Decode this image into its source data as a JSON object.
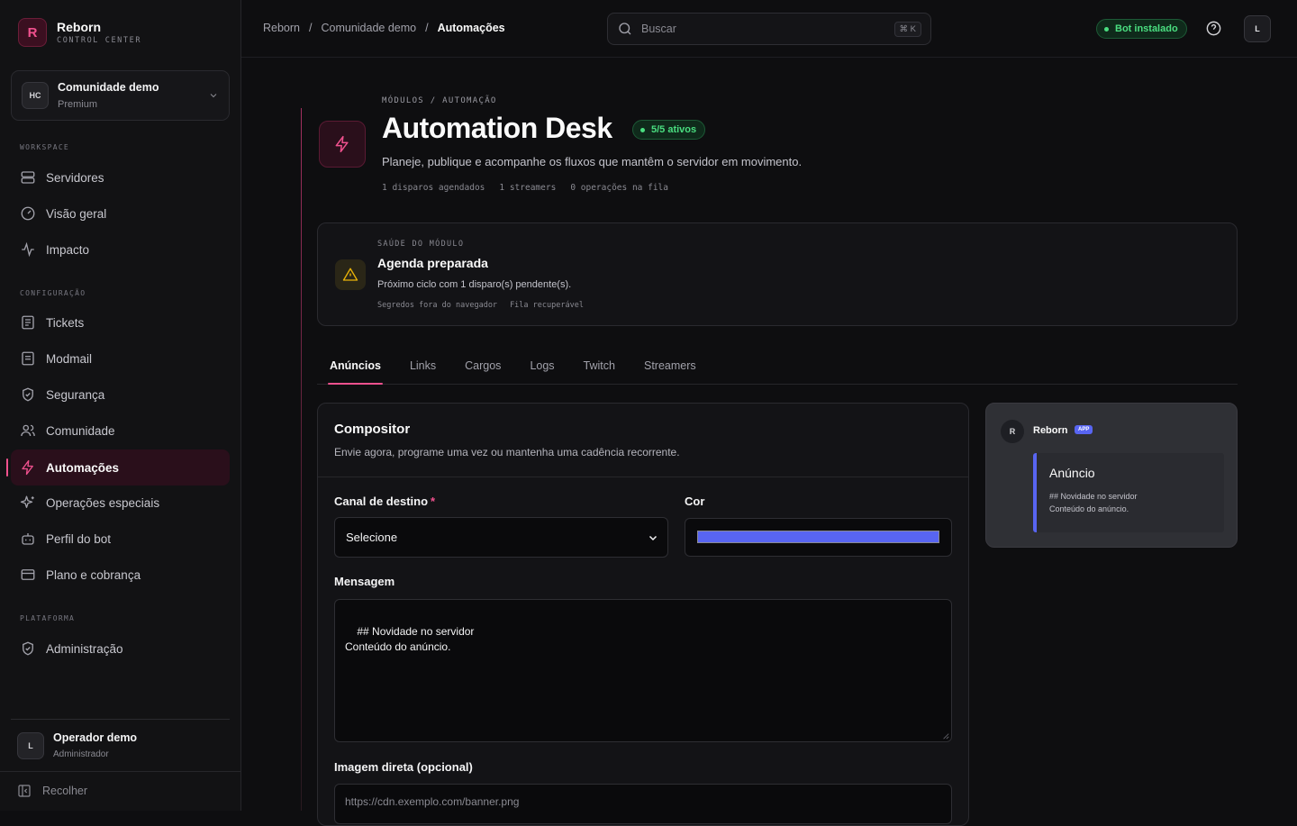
{
  "brand": {
    "name": "Reborn",
    "subtitle": "CONTROL CENTER",
    "mark": "R"
  },
  "server": {
    "initials": "HC",
    "name": "Comunidade demo",
    "plan": "Premium"
  },
  "sidebar": {
    "sections": [
      {
        "label": "WORKSPACE",
        "items": [
          {
            "label": "Servidores",
            "icon": "server-icon"
          },
          {
            "label": "Visão geral",
            "icon": "gauge-icon"
          },
          {
            "label": "Impacto",
            "icon": "activity-icon"
          }
        ]
      },
      {
        "label": "CONFIGURAÇÃO",
        "items": [
          {
            "label": "Tickets",
            "icon": "ticket-icon"
          },
          {
            "label": "Modmail",
            "icon": "mail-icon"
          },
          {
            "label": "Segurança",
            "icon": "shield-icon"
          },
          {
            "label": "Comunidade",
            "icon": "users-icon"
          },
          {
            "label": "Automações",
            "icon": "zap-icon",
            "active": true
          },
          {
            "label": "Operações especiais",
            "icon": "sparkles-icon"
          },
          {
            "label": "Perfil do bot",
            "icon": "bot-icon"
          },
          {
            "label": "Plano e cobrança",
            "icon": "credit-card-icon"
          }
        ]
      },
      {
        "label": "PLATAFORMA",
        "items": [
          {
            "label": "Administração",
            "icon": "shield-check-icon"
          }
        ]
      }
    ]
  },
  "user": {
    "initials": "L",
    "name": "Operador demo",
    "role": "Administrador"
  },
  "collapse_label": "Recolher",
  "breadcrumbs": [
    "Reborn",
    "/",
    "Comunidade demo",
    "/",
    "Automações"
  ],
  "search": {
    "placeholder": "Buscar",
    "shortcut": "⌘ K"
  },
  "bot_status": "Bot instalado",
  "top_avatar": "L",
  "hero": {
    "eyebrow": "MÓDULOS / AUTOMAÇÃO",
    "title": "Automation Desk",
    "badge": "5/5 ativos",
    "subtitle": "Planeje, publique e acompanhe os fluxos que mantêm o servidor em movimento.",
    "meta": [
      "1 disparos agendados",
      "1 streamers",
      "0 operações na fila"
    ]
  },
  "health": {
    "eyebrow": "SAÚDE DO MÓDULO",
    "title": "Agenda preparada",
    "description": "Próximo ciclo com 1 disparo(s) pendente(s).",
    "tags": [
      "Segredos fora do navegador",
      "Fila recuperável"
    ]
  },
  "tabs": [
    {
      "label": "Anúncios",
      "active": true
    },
    {
      "label": "Links"
    },
    {
      "label": "Cargos"
    },
    {
      "label": "Logs"
    },
    {
      "label": "Twitch"
    },
    {
      "label": "Streamers"
    }
  ],
  "composer": {
    "title": "Compositor",
    "subtitle": "Envie agora, programe uma vez ou mantenha uma cadência recorrente.",
    "channel_label": "Canal de destino",
    "channel_value": "Selecione",
    "color_label": "Cor",
    "color_value": "#5865f2",
    "message_label": "Mensagem",
    "message_value": "## Novidade no servidor\nConteúdo do anúncio.",
    "image_label": "Imagem direta (opcional)",
    "image_placeholder": "https://cdn.exemplo.com/banner.png"
  },
  "preview": {
    "avatar": "R",
    "name": "Reborn",
    "app_tag": "APP",
    "embed_title": "Anúncio",
    "embed_lines": [
      "## Novidade no servidor",
      "Conteúdo do anúncio."
    ]
  },
  "colors": {
    "accent": "#f0518e",
    "success": "#4ade80",
    "warning": "#eab308",
    "embed": "#5865f2"
  }
}
